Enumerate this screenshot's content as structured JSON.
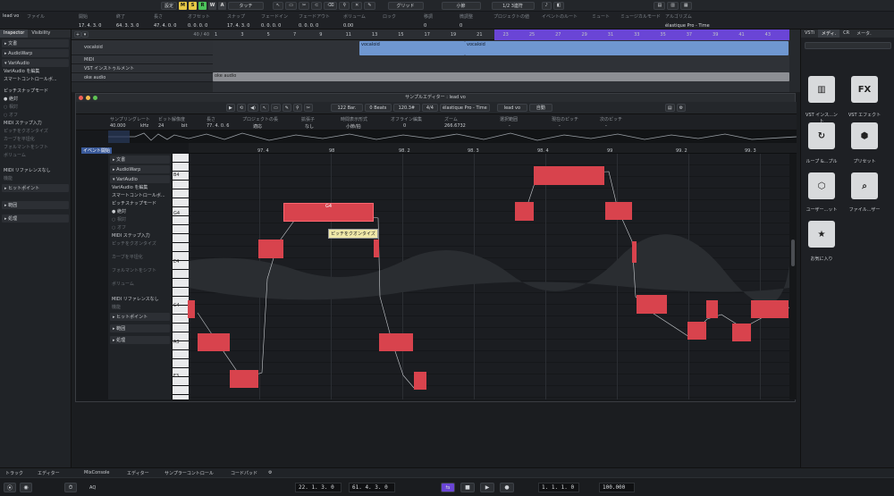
{
  "toolbar": {
    "settings_label": "設定",
    "m": "M",
    "s": "S",
    "r": "R",
    "w": "W",
    "a": "A",
    "automation_mode": "タッチ",
    "snap_type": "グリッド",
    "grid_value": "小節",
    "quantize": "1/2 3連符"
  },
  "infoline": {
    "track_name": "lead vo",
    "columns": [
      {
        "h": "ファイル",
        "v": ""
      },
      {
        "h": "開始",
        "v": "17. 4. 3. 0"
      },
      {
        "h": "終了",
        "v": "64. 3. 3. 0"
      },
      {
        "h": "長さ",
        "v": "47. 4. 0. 0"
      },
      {
        "h": "オフセット",
        "v": "0. 0. 0. 0"
      },
      {
        "h": "スナップ",
        "v": "17. 4. 3. 0"
      },
      {
        "h": "フェードイン",
        "v": "0. 0. 0. 0"
      },
      {
        "h": "フェードアウト",
        "v": "0. 0. 0. 0"
      },
      {
        "h": "ボリューム",
        "v": "0.00"
      },
      {
        "h": "ロック",
        "v": ""
      },
      {
        "h": "移調",
        "v": "0"
      },
      {
        "h": "微調整",
        "v": "0"
      },
      {
        "h": "プロジェクトの値",
        "v": ""
      },
      {
        "h": "イベントのルート",
        "v": ""
      },
      {
        "h": "ミュート",
        "v": ""
      },
      {
        "h": "ミュージカルモード",
        "v": ""
      },
      {
        "h": "アルゴリズム",
        "v": "élastique Pro - Time"
      }
    ]
  },
  "inspector": {
    "tabs": [
      "Inspector",
      "Visibility"
    ],
    "sections": [
      "文書",
      "AudioWarp",
      "VariAudio"
    ],
    "variaudio_edit": "VariAudio を編集",
    "smart_control": "スマートコントロールボ...",
    "pitch_snap_mode": "ピッチスナップモード",
    "modes": [
      "絶対",
      "相対",
      "オフ"
    ],
    "midi_step": "MIDI ステップ入力",
    "items": [
      "ピッチをクオンタイズ",
      "カーブを平坦化",
      "フォルマントをシフト",
      "ボリューム"
    ],
    "midi_ref": "MIDI リファレンスなし",
    "function": "機能",
    "hitpoint": "ヒットポイント",
    "range": "範囲",
    "process": "処理",
    "tempo_label": "サンプリング",
    "tempo_value": "40.000"
  },
  "project": {
    "ruler_ticks": [
      "1",
      "3",
      "5",
      "7",
      "9",
      "11",
      "13",
      "15",
      "17",
      "19",
      "21",
      "23",
      "25",
      "27",
      "29",
      "31",
      "33",
      "35",
      "37",
      "39",
      "41",
      "43"
    ],
    "track_count": "40 / 40",
    "tracks": [
      "vocaloid",
      "MIDI",
      "VST インストゥルメント",
      "oke audio"
    ],
    "clip_labels": [
      "vocaloid",
      "vocaloid",
      "oke audio"
    ]
  },
  "editor": {
    "title": "サンプルエディター : lead vo",
    "bars": "122 Bar.",
    "beats": "0 Beats",
    "tempo": "120.3#",
    "signature": "4/4",
    "algorithm": "élastique Pro - Time",
    "track": "lead vo",
    "auto": "自動",
    "info_headers": [
      "サンプリングレート",
      "ビット解像度",
      "長さ",
      "プロジェクトの長",
      "拡張子",
      "時間表示形式",
      "オフライン編集",
      "ズーム",
      "選択範囲",
      "現在のピッチ",
      "次のピッチ"
    ],
    "info_values": [
      "40.000",
      "kHz",
      "24",
      "bit",
      "77. 4. 0. 6",
      "適応",
      "なし",
      "小節/拍",
      "0",
      "266.6732",
      "-",
      "-",
      "-"
    ],
    "event_label": "イベント開始",
    "ruler_ticks": [
      "97. 4",
      "98",
      "98. 2",
      "98. 3",
      "98. 4",
      "99",
      "99. 2",
      "99. 3"
    ],
    "note_tooltip": "ピッチをクオンタイズ",
    "selected_note_label": "G4",
    "key_labels": [
      "B4",
      "G4",
      "E4",
      "C4",
      "A3",
      "F3"
    ]
  },
  "media_bay": {
    "tabs": [
      "VSTi",
      "メディ.",
      "CR",
      "メータ."
    ],
    "tiles": [
      {
        "label": "VST インス...ント",
        "icon": "piano-icon"
      },
      {
        "label": "VST エフェクト",
        "icon": "fx-icon"
      },
      {
        "label": "ループ &...プル",
        "icon": "loop-icon"
      },
      {
        "label": "プリセット",
        "icon": "preset-icon"
      },
      {
        "label": "ユーザー...ット",
        "icon": "user-preset-icon"
      },
      {
        "label": "ファイル...ザー",
        "icon": "file-browser-icon"
      },
      {
        "label": "お気に入り",
        "icon": "favorite-icon"
      }
    ]
  },
  "bottom": {
    "left_tabs": [
      "トラック",
      "エディター"
    ],
    "tabs": [
      "MixConsole",
      "エディター",
      "サンプラーコントロール",
      "コードパッド"
    ],
    "left_locator": "22. 1. 3. 0",
    "right_locator": "61. 4. 3. 0",
    "position": "1. 1. 1. 0",
    "tempo": "100.000",
    "aq": "AQ"
  },
  "colors": {
    "note_red": "#d8434d",
    "clip_blue": "#6f97d0",
    "selection_purple": "#6a45d6",
    "m_yellow": "#e6c846",
    "s_green": "#4cc25a"
  }
}
